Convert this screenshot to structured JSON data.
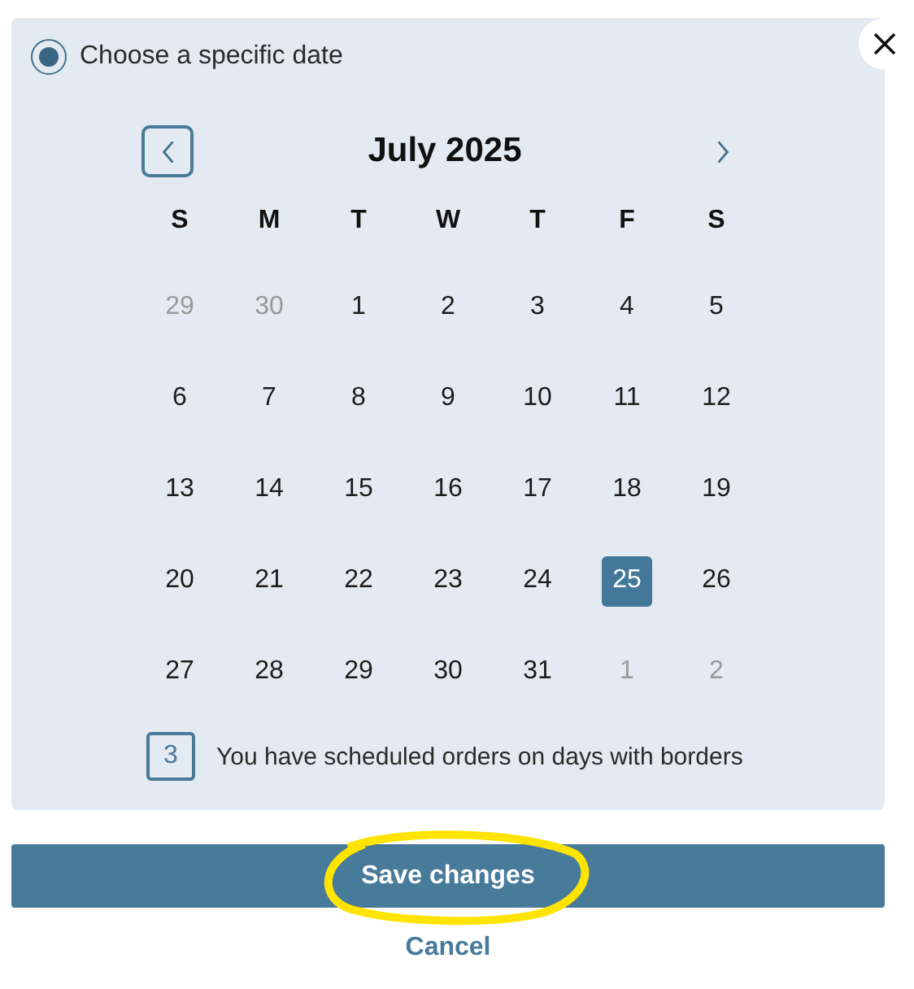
{
  "option": {
    "label": "Choose a specific date",
    "selected": true
  },
  "calendar": {
    "month": "July 2025",
    "weekdays": [
      "S",
      "M",
      "T",
      "W",
      "T",
      "F",
      "S"
    ],
    "days": [
      {
        "label": "29",
        "muted": true,
        "selected": false
      },
      {
        "label": "30",
        "muted": true,
        "selected": false
      },
      {
        "label": "1",
        "muted": false,
        "selected": false
      },
      {
        "label": "2",
        "muted": false,
        "selected": false
      },
      {
        "label": "3",
        "muted": false,
        "selected": false
      },
      {
        "label": "4",
        "muted": false,
        "selected": false
      },
      {
        "label": "5",
        "muted": false,
        "selected": false
      },
      {
        "label": "6",
        "muted": false,
        "selected": false
      },
      {
        "label": "7",
        "muted": false,
        "selected": false
      },
      {
        "label": "8",
        "muted": false,
        "selected": false
      },
      {
        "label": "9",
        "muted": false,
        "selected": false
      },
      {
        "label": "10",
        "muted": false,
        "selected": false
      },
      {
        "label": "11",
        "muted": false,
        "selected": false
      },
      {
        "label": "12",
        "muted": false,
        "selected": false
      },
      {
        "label": "13",
        "muted": false,
        "selected": false
      },
      {
        "label": "14",
        "muted": false,
        "selected": false
      },
      {
        "label": "15",
        "muted": false,
        "selected": false
      },
      {
        "label": "16",
        "muted": false,
        "selected": false
      },
      {
        "label": "17",
        "muted": false,
        "selected": false
      },
      {
        "label": "18",
        "muted": false,
        "selected": false
      },
      {
        "label": "19",
        "muted": false,
        "selected": false
      },
      {
        "label": "20",
        "muted": false,
        "selected": false
      },
      {
        "label": "21",
        "muted": false,
        "selected": false
      },
      {
        "label": "22",
        "muted": false,
        "selected": false
      },
      {
        "label": "23",
        "muted": false,
        "selected": false
      },
      {
        "label": "24",
        "muted": false,
        "selected": false
      },
      {
        "label": "25",
        "muted": false,
        "selected": true
      },
      {
        "label": "26",
        "muted": false,
        "selected": false
      },
      {
        "label": "27",
        "muted": false,
        "selected": false
      },
      {
        "label": "28",
        "muted": false,
        "selected": false
      },
      {
        "label": "29",
        "muted": false,
        "selected": false
      },
      {
        "label": "30",
        "muted": false,
        "selected": false
      },
      {
        "label": "31",
        "muted": false,
        "selected": false
      },
      {
        "label": "1",
        "muted": true,
        "selected": false
      },
      {
        "label": "2",
        "muted": true,
        "selected": false
      }
    ]
  },
  "legend": {
    "sample": "3",
    "text": "You have scheduled orders on days with borders"
  },
  "save_button": {
    "label": "Save changes",
    "highlighted": true
  },
  "cancel_link": "Cancel"
}
